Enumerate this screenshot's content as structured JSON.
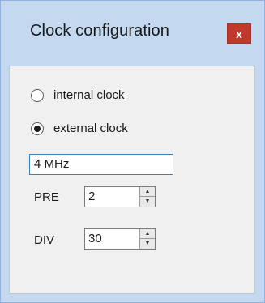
{
  "window": {
    "title": "Clock configuration",
    "close_label": "x"
  },
  "clock_source": {
    "options": [
      {
        "label": "internal clock",
        "checked": false
      },
      {
        "label": "external clock",
        "checked": true
      }
    ]
  },
  "frequency_input": {
    "value": "4 MHz"
  },
  "pre": {
    "label": "PRE",
    "value": "2"
  },
  "div": {
    "label": "DIV",
    "value": "30"
  },
  "icons": {
    "close": "close-icon",
    "spin_up": "chevron-up-icon",
    "spin_down": "chevron-down-icon"
  }
}
